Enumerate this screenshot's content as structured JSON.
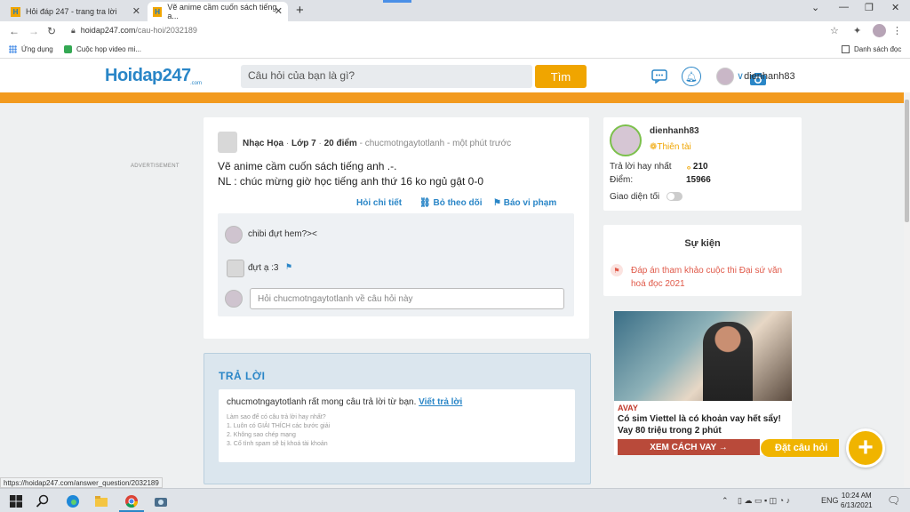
{
  "browser": {
    "tabs": [
      {
        "title": "Hỏi đáp 247 - trang tra lời",
        "active": false
      },
      {
        "title": "Vẽ anime cầm cuốn sách tiếng a...",
        "active": true
      }
    ],
    "url_domain": "hoidap247.com",
    "url_path": "/cau-hoi/2032189",
    "bookmarks": [
      "Ứng dụng",
      "Cuộc họp video mi..."
    ],
    "reading_list": "Danh sách đọc"
  },
  "site": {
    "logo": "Hoidap247",
    "logo_sub": ".com",
    "search_placeholder": "Câu hỏi của bạn là gì?",
    "find_button": "Tìm",
    "username": "dienhanh83"
  },
  "sidebar_left": {
    "ad_label": "ADVERTISEMENT"
  },
  "question": {
    "author": "Nhạc Họa",
    "grade": "Lớp 7",
    "points": "20 điểm",
    "asker_time": "chucmotngaytotlanh - một phút trước",
    "line1": "Vẽ anime cầm cuốn sách tiếng anh .-.",
    "line2": "NL : chúc mừng giờ học tiếng anh thứ 16 ko ngủ gật 0-0",
    "actions": {
      "detail": "Hỏi chi tiết",
      "unfollow": "Bỏ theo dõi",
      "report": "Báo vi phạm"
    },
    "comments": [
      {
        "text": "chibi đựt hem?><"
      },
      {
        "text": "đựt ạ :3"
      }
    ],
    "comment_placeholder": "Hỏi chucmotngaytotlanh về câu hỏi này"
  },
  "answer": {
    "title": "TRẢ LỜI",
    "prompt": "chucmotngaytotlanh rất mong câu trả lời từ bạn.",
    "write_link": "Viết trả lời",
    "tips_title": "Làm sao để có câu trả lời hay nhất?",
    "tips": [
      "1. Luôn có GIẢI THÍCH các bước giải",
      "2. Không sao chép mạng",
      "3. Cố tình spam sẽ bị khoá tài khoản"
    ]
  },
  "user_card": {
    "name": "dienhanh83",
    "rank": "Thiên tài",
    "best_answers_label": "Trả lời hay nhất",
    "best_answers": "210",
    "points_label": "Điểm:",
    "points": "15966",
    "theme_label": "Giao diện tối"
  },
  "events": {
    "title": "Sự kiện",
    "item": "Đáp án tham khảo cuộc thi Đại sứ văn hoá đọc 2021"
  },
  "ad": {
    "brand": "AVAY",
    "headline": "Có sim Viettel là có khoản vay hết sẩy! Vay 80 triệu trong 2 phút",
    "cta": "XEM CÁCH VAY →"
  },
  "ask_button": "Đặt câu hỏi",
  "status_url": "https://hoidap247.com/answer_question/2032189",
  "taskbar": {
    "lang": "ENG",
    "time": "10:24 AM",
    "date": "6/13/2021"
  }
}
